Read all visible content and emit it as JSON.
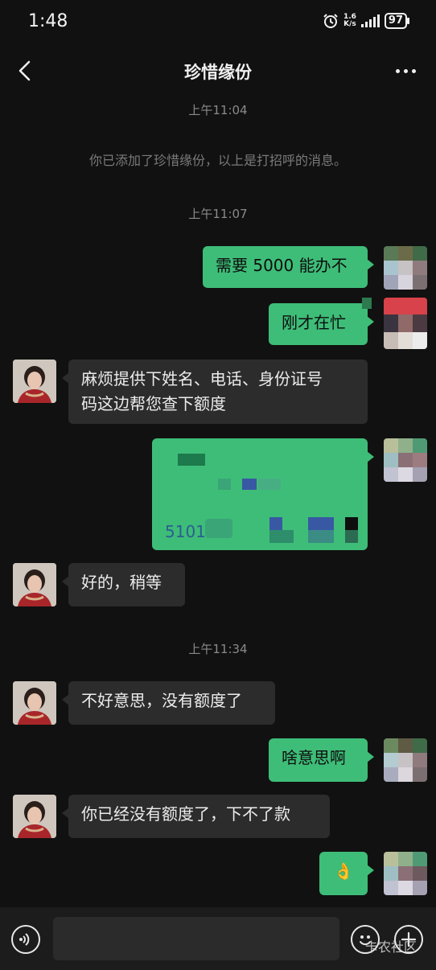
{
  "status_bar": {
    "time": "1:48",
    "net_speed_value": "1.6",
    "net_speed_unit": "K/s",
    "battery": "97",
    "icons": [
      "alarm-icon",
      "signal-icon",
      "battery-icon"
    ]
  },
  "header": {
    "title": "珍惜缘份",
    "back_icon": "chevron-left-icon",
    "more_icon": "more-dots-icon"
  },
  "messages": {
    "ts1": "上午11:04",
    "system_notice": "你已添加了珍惜缘份，以上是打招呼的消息。",
    "ts2": "上午11:07",
    "m1": "需要 5000 能办不",
    "m2": "刚才在忙",
    "m3_line1": "麻烦提供下姓名、电话、身份证号",
    "m3_line2": "码这边帮您查下额度",
    "m4_partial": "5101",
    "m5": "好的，稍等",
    "ts3": "上午11:34",
    "m6": "不好意思，没有额度了",
    "m7": "啥意思啊",
    "m8": "你已经没有额度了，下不了款",
    "m9": "👌"
  },
  "watermark": "卡农社区",
  "colors": {
    "background": "#111111",
    "my_bubble": "#3ebd78",
    "their_bubble": "#2c2c2c",
    "timestamp": "#8a8a8a"
  }
}
